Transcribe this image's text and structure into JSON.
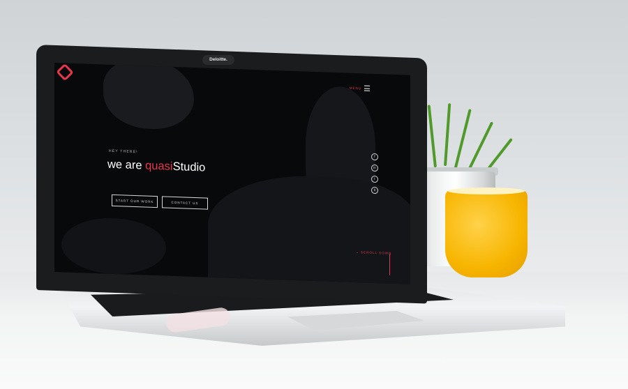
{
  "laptop": {
    "webcam_brand": "Deloitte."
  },
  "website": {
    "menu_label": "MENU",
    "greeting": "HEY THERE!",
    "headline_prefix": "we are ",
    "headline_accent": "quasi",
    "headline_suffix": "Studio",
    "buttons": [
      "START OUR WORK",
      "CONTACT US"
    ],
    "social_icons": [
      "facebook-icon",
      "linkedin-icon",
      "twitter-icon",
      "behance-icon"
    ],
    "social_glyphs": [
      "f",
      "in",
      "t",
      "b"
    ],
    "scroll_label": "SCROLL DOWN",
    "colors": {
      "accent": "#e8364e",
      "background": "#08090a",
      "text": "#ffffff"
    }
  }
}
